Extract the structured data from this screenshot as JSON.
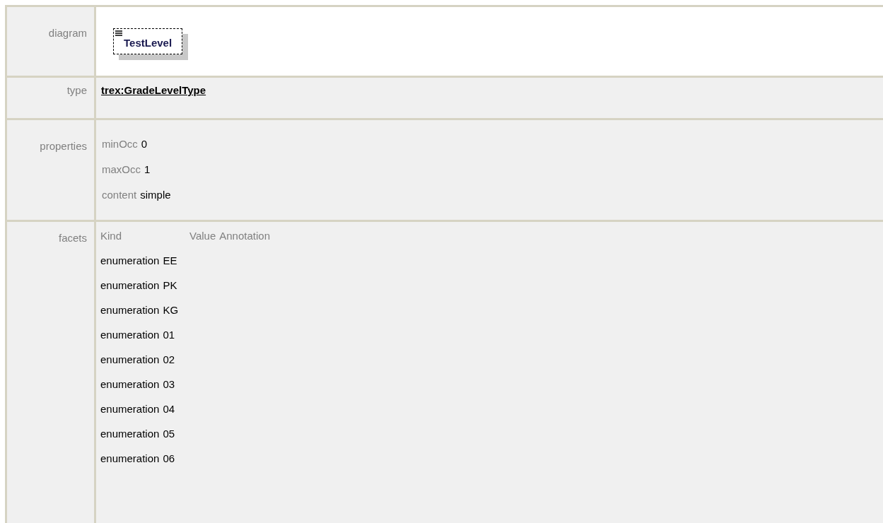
{
  "diagram": {
    "label": "diagram",
    "element": {
      "name": "TestLevel",
      "optional": true
    }
  },
  "type": {
    "label": "type",
    "value": "trex:GradeLevelType"
  },
  "properties": {
    "label": "properties",
    "items": [
      {
        "name": "minOcc",
        "value": "0"
      },
      {
        "name": "maxOcc",
        "value": "1"
      },
      {
        "name": "content",
        "value": "simple"
      }
    ]
  },
  "facets": {
    "label": "facets",
    "columns": [
      "Kind",
      "Value",
      "Annotation"
    ],
    "rows": [
      {
        "kind": "enumeration",
        "value": "EE"
      },
      {
        "kind": "enumeration",
        "value": "PK"
      },
      {
        "kind": "enumeration",
        "value": "KG"
      },
      {
        "kind": "enumeration",
        "value": "01"
      },
      {
        "kind": "enumeration",
        "value": "02"
      },
      {
        "kind": "enumeration",
        "value": "03"
      },
      {
        "kind": "enumeration",
        "value": "04"
      },
      {
        "kind": "enumeration",
        "value": "05"
      },
      {
        "kind": "enumeration",
        "value": "06"
      }
    ]
  }
}
